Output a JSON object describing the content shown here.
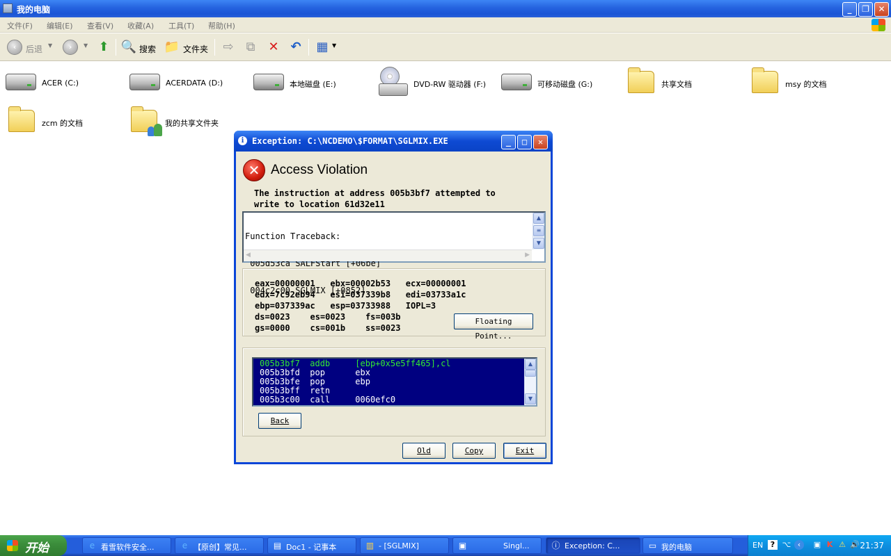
{
  "window": {
    "title": "我的电脑",
    "controls": {
      "minimize": "_",
      "maximize": "❐",
      "close": "✕"
    }
  },
  "menubar": [
    "文件(F)",
    "编辑(E)",
    "查看(V)",
    "收藏(A)",
    "工具(T)",
    "帮助(H)"
  ],
  "toolbar": {
    "back_label": "后退",
    "search_label": "搜索",
    "folders_label": "文件夹"
  },
  "items": [
    {
      "label": "ACER (C:)",
      "icon": "hard-drive-icon"
    },
    {
      "label": "ACERDATA (D:)",
      "icon": "hard-drive-icon"
    },
    {
      "label": "本地磁盘 (E:)",
      "icon": "hard-drive-icon"
    },
    {
      "label": "DVD-RW 驱动器 (F:)",
      "icon": "dvd-drive-icon"
    },
    {
      "label": "可移动磁盘 (G:)",
      "icon": "removable-drive-icon"
    },
    {
      "label": "共享文档",
      "icon": "folder-icon"
    },
    {
      "label": "msy 的文档",
      "icon": "folder-icon"
    },
    {
      "label": "zcm 的文档",
      "icon": "folder-icon"
    },
    {
      "label": "我的共享文件夹",
      "icon": "shared-folder-icon"
    }
  ],
  "dialog": {
    "title": "Exception: C:\\NCDEMO\\$FORMAT\\SGLMIX.EXE",
    "heading": "Access Violation",
    "message_line1": "The instruction at address 005b3bf7 attempted to",
    "message_line2": "write to location 61d32e11",
    "traceback": [
      "Function Traceback:",
      " 005d53ca SALFStart [+06be]",
      " 004c2c00 SGLMIX [+0852]"
    ],
    "registers": [
      "eax=00000001   ebx=00002b53   ecx=00000001",
      "edx=7c92eb94   esi=037339b8   edi=03733a1c",
      "ebp=037339ac   esp=03733988   IOPL=3",
      "ds=0023    es=0023    fs=003b",
      "gs=0000    cs=001b    ss=0023"
    ],
    "floating_point_button": "Floating Point...",
    "disassembly": [
      "005b3bf7  addb     [ebp+0x5e5ff465],cl",
      "005b3bfd  pop      ebx",
      "005b3bfe  pop      ebp",
      "005b3bff  retn",
      "005b3c00  call     0060efc0"
    ],
    "back_button": "Back",
    "old_button": "Old",
    "copy_button": "Copy",
    "exit_button": "Exit"
  },
  "taskbar": {
    "start_label": "开始",
    "tasks": [
      "看雪软件安全...",
      "【原创】常见...",
      "Doc1 - 记事本",
      "- [SGLMIX]",
      "Singl...",
      "Exception: C...",
      "我的电脑"
    ],
    "tray": {
      "language": "EN",
      "help": "?",
      "clock": "21:37"
    }
  },
  "colors": {
    "title_blue": "#245edb",
    "dialog_border": "#0a46d8",
    "disasm_bg": "#000080",
    "disasm_current": "#33e833",
    "start_green": "#3c8e3c"
  }
}
